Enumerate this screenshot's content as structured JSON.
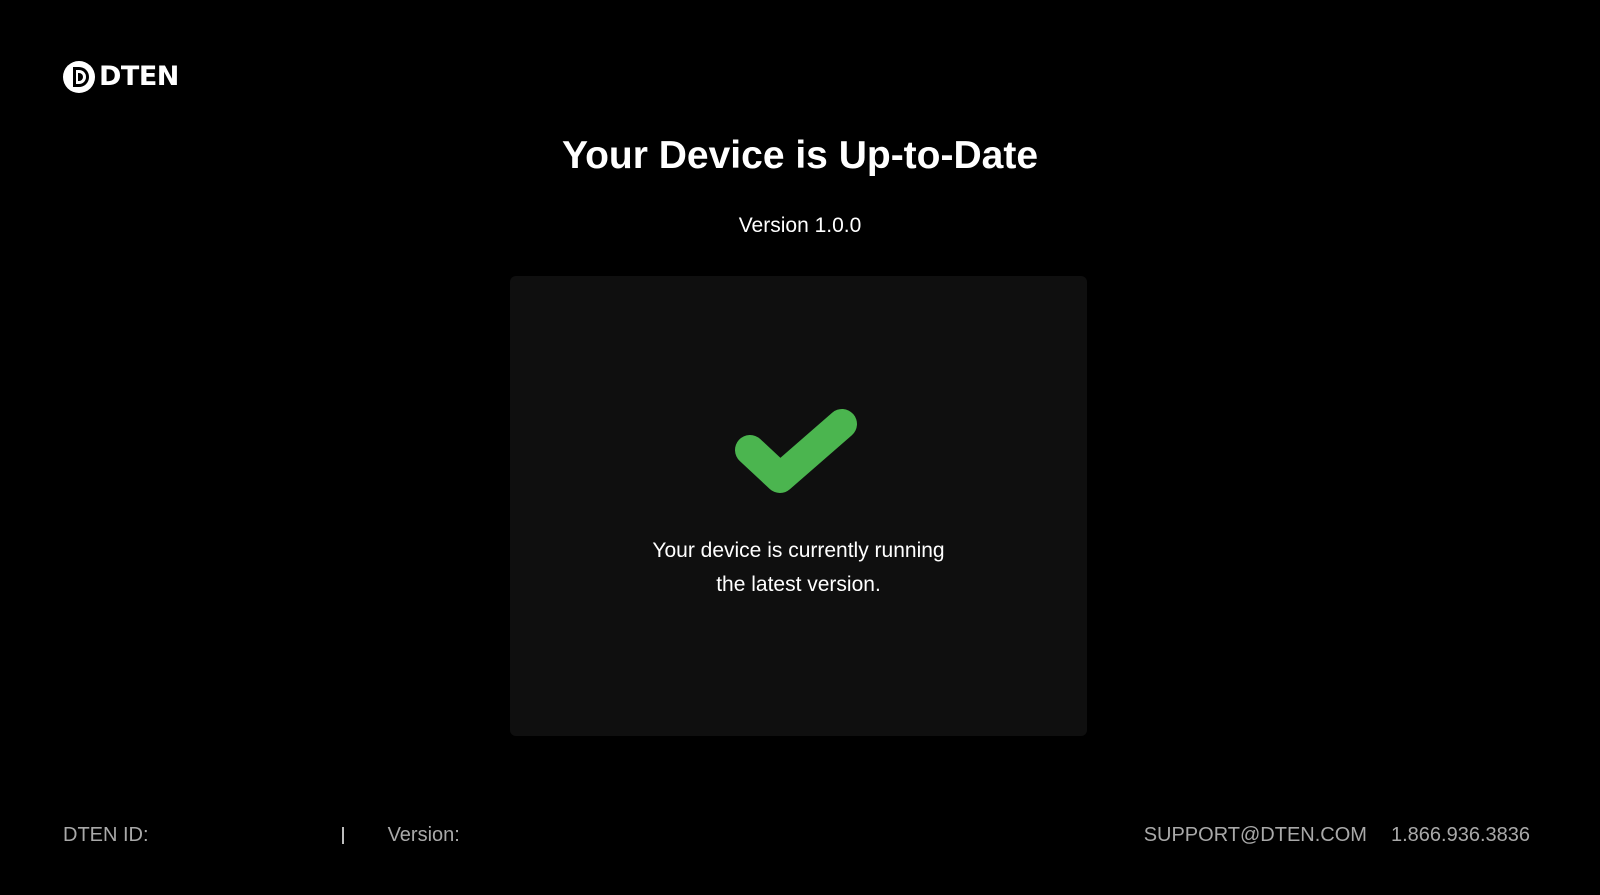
{
  "brand": {
    "name": "DTEN",
    "logo_icon": "dten-logo-icon"
  },
  "header": {
    "title": "Your Device is Up-to-Date",
    "version": "Version 1.0.0"
  },
  "status_card": {
    "icon": "checkmark-icon",
    "icon_color": "#4bb54f",
    "message_line1": "Your device is currently running",
    "message_line2": "the latest version."
  },
  "footer": {
    "id_label": "DTEN ID:",
    "id_value": "",
    "version_label": "Version:",
    "version_value": "",
    "support_email": "SUPPORT@DTEN.COM",
    "support_phone": "1.866.936.3836"
  },
  "colors": {
    "background": "#000000",
    "card": "#0f0f0f",
    "text": "#ffffff",
    "footer_text": "#a9a9a9",
    "accent_green": "#4bb54f"
  }
}
